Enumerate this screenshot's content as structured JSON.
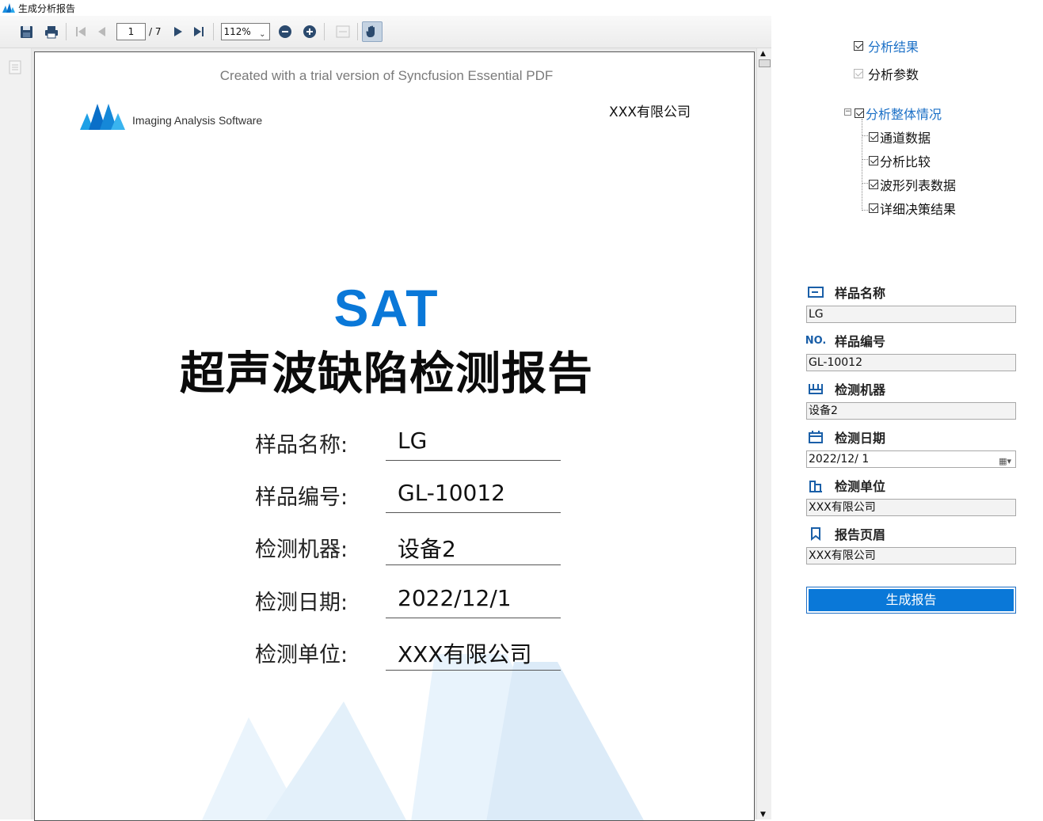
{
  "window": {
    "title": "生成分析报告"
  },
  "toolbar": {
    "current_page": "1",
    "total_pages": "/ 7",
    "zoom": "112%"
  },
  "document": {
    "trial_notice": "Created with a trial version of Syncfusion Essential PDF",
    "logo_text": "Imaging Analysis Software",
    "company_header": "XXX有限公司",
    "sat": "SAT",
    "title": "超声波缺陷检测报告",
    "fields": [
      {
        "label": "样品名称:",
        "value": "LG"
      },
      {
        "label": "样品编号:",
        "value": "GL-10012"
      },
      {
        "label": "检测机器:",
        "value": "设备2"
      },
      {
        "label": "检测日期:",
        "value": "2022/12/1"
      },
      {
        "label": "检测单位:",
        "value": "XXX有限公司"
      }
    ]
  },
  "options": {
    "analysis_result": "分析结果",
    "analysis_params": "分析参数",
    "overall": "分析整体情况",
    "children": [
      "通道数据",
      "分析比较",
      "波形列表数据",
      "详细决策结果"
    ]
  },
  "form": {
    "sample_name": {
      "label": "样品名称",
      "value": "LG"
    },
    "sample_no": {
      "label": "样品编号",
      "value": "GL-10012",
      "icon_text": "NO."
    },
    "machine": {
      "label": "检测机器",
      "value": "设备2"
    },
    "date": {
      "label": "检测日期",
      "value": "2022/12/ 1"
    },
    "unit": {
      "label": "检测单位",
      "value": "XXX有限公司"
    },
    "header": {
      "label": "报告页眉",
      "value": "XXX有限公司"
    },
    "generate": "生成报告"
  },
  "colors": {
    "accent": "#0a78d8",
    "link": "#1a6fc6"
  }
}
